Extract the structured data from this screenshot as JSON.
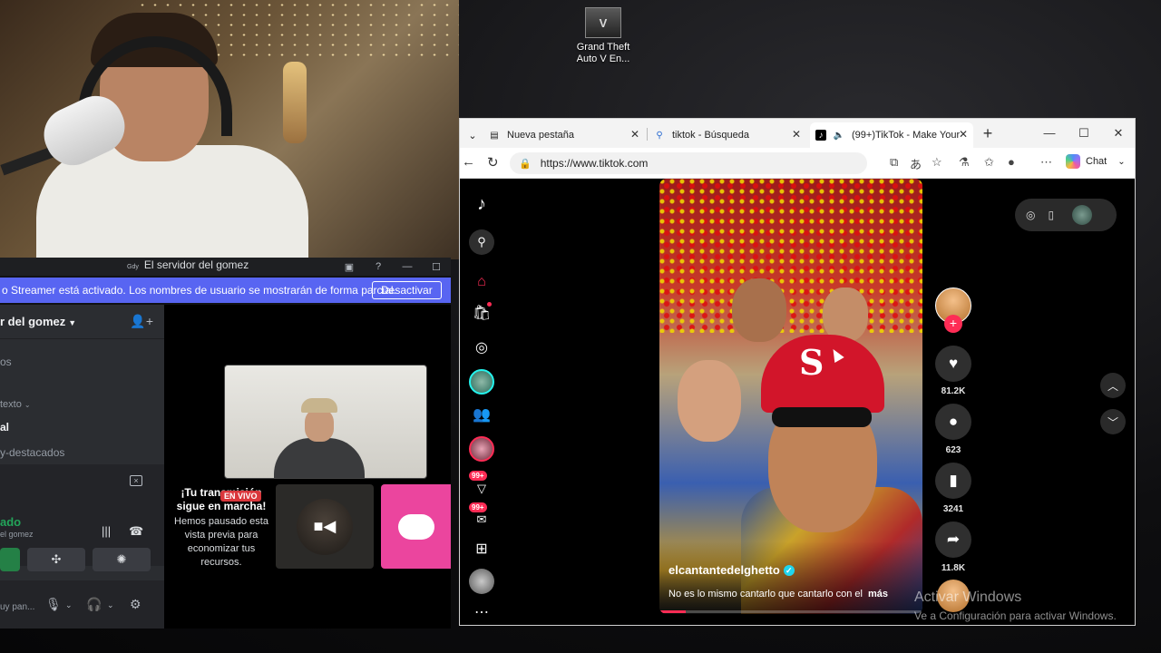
{
  "desktop": {
    "shortcut": {
      "icon": "gta-v-icon",
      "label_line1": "Grand Theft",
      "label_line2": "Auto V En..."
    },
    "activation": {
      "title": "Activar Windows",
      "subtitle": "Ve a Configuración para activar Windows."
    }
  },
  "discord": {
    "window_title": "El servidor del gomez",
    "streamer_banner": {
      "text": "o Streamer está activado. Los nombres de usuario se mostrarán de forma parcial.",
      "button": "Desactivar"
    },
    "server_name": "r del gomez",
    "channels": [
      {
        "label": "os"
      },
      {
        "label": "texto"
      },
      {
        "label": "al"
      },
      {
        "label": "y-destacados"
      }
    ],
    "voice": {
      "status": "ado",
      "sub": "el gomez"
    },
    "user": {
      "name": "uy pan..."
    },
    "stream": {
      "paused_title": "¡Tu transmisión sigue en marcha!",
      "live_badge": "EN VIVO",
      "paused_body": "Hemos pausado esta vista previa para economizar tus recursos."
    }
  },
  "browser": {
    "tabs": [
      {
        "label": "Nueva pestaña",
        "icon": "new-tab-icon"
      },
      {
        "label": "tiktok - Búsqueda",
        "icon": "search-icon"
      },
      {
        "label": "(99+)TikTok - Make Your",
        "icon": "tiktok-icon",
        "active": true
      }
    ],
    "url": "https://www.tiktok.com",
    "chat_label": "Chat"
  },
  "tiktok": {
    "rail_badges": [
      "99+",
      "99+"
    ],
    "video": {
      "author": "elcantantedelghetto",
      "caption": "No es lo mismo cantarlo que cantarlo con el",
      "more": "más",
      "progress": 0.1
    },
    "counts": {
      "likes": "81.2K",
      "comments": "623",
      "saves": "3241",
      "shares": "11.8K"
    },
    "colors": {
      "brand": "#fe2c55",
      "accent": "#25f4ee"
    }
  }
}
